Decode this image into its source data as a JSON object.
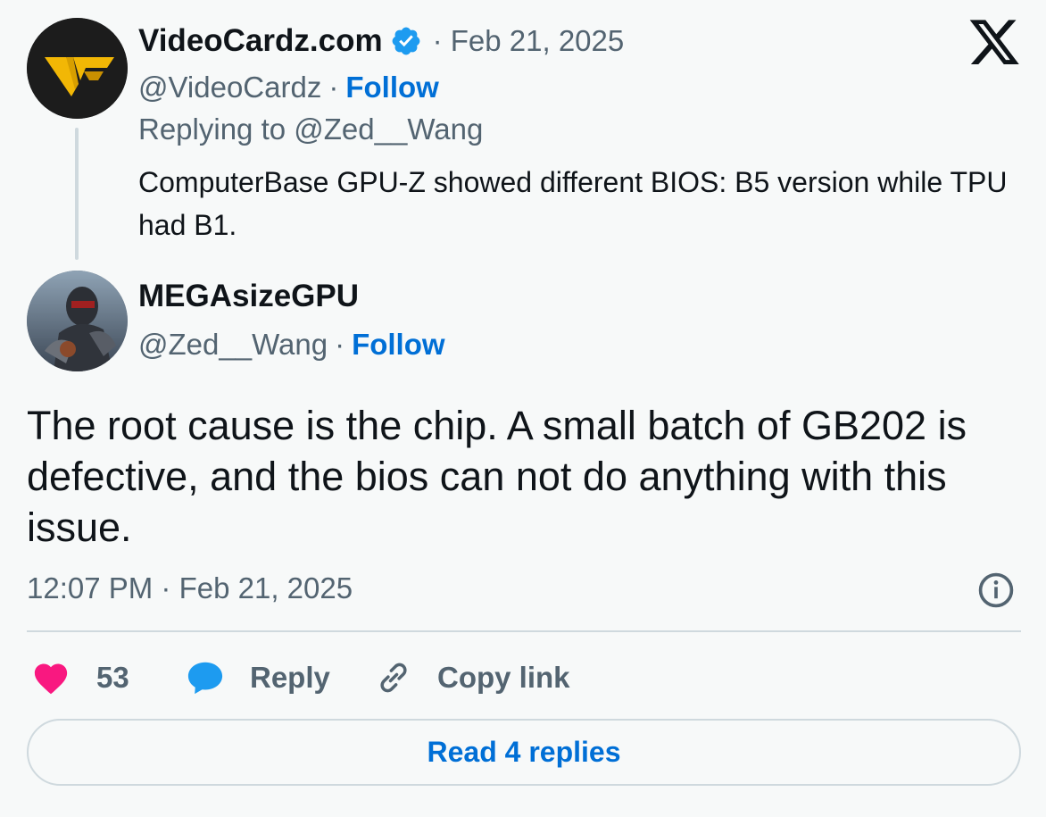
{
  "parent_tweet": {
    "display_name": "VideoCardz.com",
    "verified": true,
    "date": "· Feb 21, 2025",
    "handle": "@VideoCardz",
    "separator": "·",
    "follow_label": "Follow",
    "replying_to": "Replying to @Zed__Wang",
    "text": "ComputerBase GPU-Z showed different BIOS: B5 version while TPU had B1."
  },
  "reply_tweet": {
    "display_name": "MEGAsizeGPU",
    "handle": "@Zed__Wang",
    "separator": "·",
    "follow_label": "Follow",
    "text": "The root cause is the chip. A small batch of GB202 is defective, and the bios can not do anything with this issue.",
    "timestamp": "12:07 PM · Feb 21, 2025"
  },
  "actions": {
    "like_count": "53",
    "reply_label": "Reply",
    "copy_link_label": "Copy link"
  },
  "read_replies_label": "Read 4 replies",
  "icons": {
    "brand": "x-logo-icon",
    "verified": "verified-badge-icon",
    "info": "info-icon",
    "like": "heart-icon",
    "reply": "reply-bubble-icon",
    "copy": "link-icon"
  },
  "colors": {
    "background": "#f7f9f9",
    "text": "#0f1419",
    "secondary": "#536471",
    "link": "#006fd6",
    "like": "#f91880",
    "reply": "#1d9bf0",
    "verified": "#1d9bf0",
    "border": "#cfd9de"
  }
}
